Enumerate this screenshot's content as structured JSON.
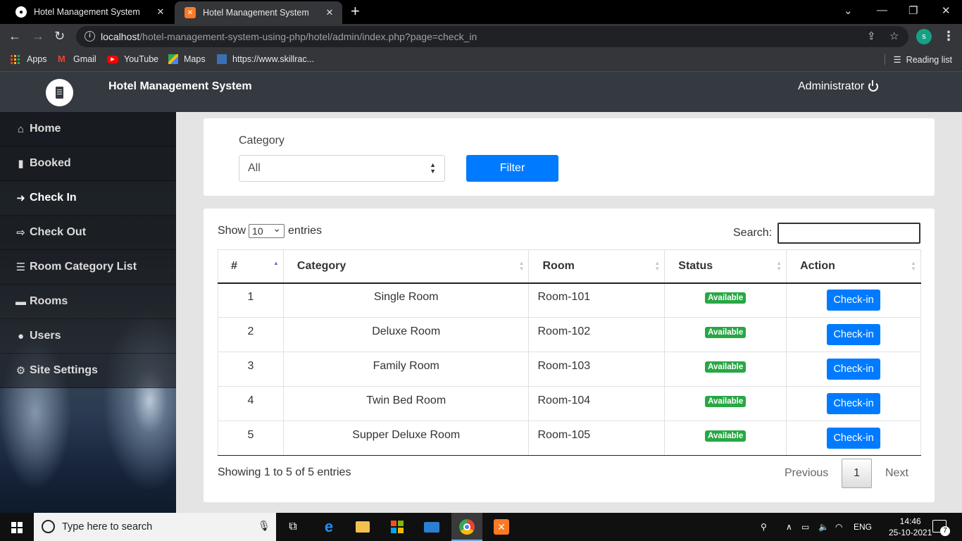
{
  "browser": {
    "tabs": [
      {
        "title": "Hotel Management System"
      },
      {
        "title": "Hotel Management System"
      }
    ],
    "url_host": "localhost",
    "url_path": "/hotel-management-system-using-php/hotel/admin/index.php?page=check_in",
    "profile_initial": "s",
    "bookmarks": [
      "Apps",
      "Gmail",
      "YouTube",
      "Maps",
      "https://www.skillrac..."
    ],
    "reading_list": "Reading list"
  },
  "header": {
    "title": "Hotel Management System",
    "user": "Administrator"
  },
  "sidebar": {
    "items": [
      {
        "label": "Home",
        "icon": "home-icon",
        "active": false
      },
      {
        "label": "Booked",
        "icon": "book-icon",
        "active": false
      },
      {
        "label": "Check In",
        "icon": "sign-in-icon",
        "active": true
      },
      {
        "label": "Check Out",
        "icon": "sign-out-icon",
        "active": false
      },
      {
        "label": "Room Category List",
        "icon": "list-icon",
        "active": false
      },
      {
        "label": "Rooms",
        "icon": "bed-icon",
        "active": false
      },
      {
        "label": "Users",
        "icon": "users-icon",
        "active": false
      },
      {
        "label": "Site Settings",
        "icon": "cogs-icon",
        "active": false
      }
    ]
  },
  "filter": {
    "label": "Category",
    "selected": "All",
    "button": "Filter"
  },
  "table": {
    "show_label": "Show",
    "entries_value": "10",
    "entries_label": "entries",
    "search_label": "Search:",
    "columns": [
      "#",
      "Category",
      "Room",
      "Status",
      "Action"
    ],
    "rows": [
      {
        "num": "1",
        "category": "Single Room",
        "room": "Room-101",
        "status": "Available",
        "action": "Check-in"
      },
      {
        "num": "2",
        "category": "Deluxe Room",
        "room": "Room-102",
        "status": "Available",
        "action": "Check-in"
      },
      {
        "num": "3",
        "category": "Family Room",
        "room": "Room-103",
        "status": "Available",
        "action": "Check-in"
      },
      {
        "num": "4",
        "category": "Twin Bed Room",
        "room": "Room-104",
        "status": "Available",
        "action": "Check-in"
      },
      {
        "num": "5",
        "category": "Supper Deluxe Room",
        "room": "Room-105",
        "status": "Available",
        "action": "Check-in"
      }
    ],
    "info": "Showing 1 to 5 of 5 entries",
    "pagination": {
      "previous": "Previous",
      "page": "1",
      "next": "Next"
    }
  },
  "taskbar": {
    "search_placeholder": "Type here to search",
    "language": "ENG",
    "time": "14:46",
    "date": "25-10-2021",
    "notifications": "7"
  }
}
